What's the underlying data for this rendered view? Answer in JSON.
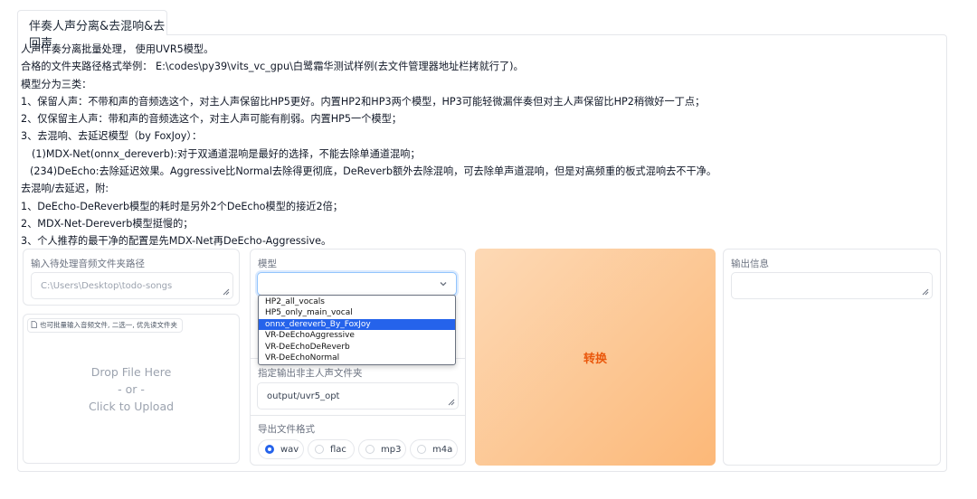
{
  "tab": {
    "label": "伴奏人声分离&去混响&去回声"
  },
  "description": [
    "人声伴奏分离批量处理， 使用UVR5模型。",
    "合格的文件夹路径格式举例： E:\\codes\\py39\\vits_vc_gpu\\白鹭霜华测试样例(去文件管理器地址栏拷就行了)。",
    "模型分为三类：",
    "1、保留人声：不带和声的音频选这个，对主人声保留比HP5更好。内置HP2和HP3两个模型，HP3可能轻微漏伴奏但对主人声保留比HP2稍微好一丁点；",
    "2、仅保留主人声：带和声的音频选这个，对主人声可能有削弱。内置HP5一个模型；",
    "3、去混响、去延迟模型（by FoxJoy）：",
    "(1)MDX-Net(onnx_dereverb):对于双通道混响是最好的选择，不能去除单通道混响；",
    "(234)DeEcho:去除延迟效果。Aggressive比Normal去除得更彻底，DeReverb额外去除混响，可去除单声道混响，但是对高频重的板式混响去不干净。",
    "去混响/去延迟，附:",
    "1、DeEcho-DeReverb模型的耗时是另外2个DeEcho模型的接近2倍；",
    "2、MDX-Net-Dereverb模型挺慢的；",
    "3、个人推荐的最干净的配置是先MDX-Net再DeEcho-Aggressive。"
  ],
  "input_dir": {
    "label": "输入待处理音频文件夹路径",
    "placeholder": "C:\\Users\\Desktop\\todo-songs"
  },
  "upload": {
    "tag": "也可批量输入音频文件, 二选一, 优先读文件夹",
    "drop": "Drop File Here",
    "or": "- or -",
    "click": "Click to Upload"
  },
  "model": {
    "label": "模型",
    "value": "",
    "options": [
      "HP2_all_vocals",
      "HP5_only_main_vocal",
      "onnx_dereverb_By_FoxJoy",
      "VR-DeEchoAggressive",
      "VR-DeEchoDeReverb",
      "VR-DeEchoNormal"
    ],
    "highlighted": "onnx_dereverb_By_FoxJoy"
  },
  "other_dir": {
    "label": "指定输出非主人声文件夹",
    "value": "output/uvr5_opt"
  },
  "format": {
    "label": "导出文件格式",
    "options": [
      "wav",
      "flac",
      "mp3",
      "m4a"
    ],
    "selected": "wav"
  },
  "convert": {
    "label": "转换"
  },
  "output": {
    "label": "输出信息",
    "value": ""
  },
  "colors": {
    "accent": "#2563eb",
    "convert_text": "#ea580c",
    "convert_bg": "#fcb878"
  }
}
